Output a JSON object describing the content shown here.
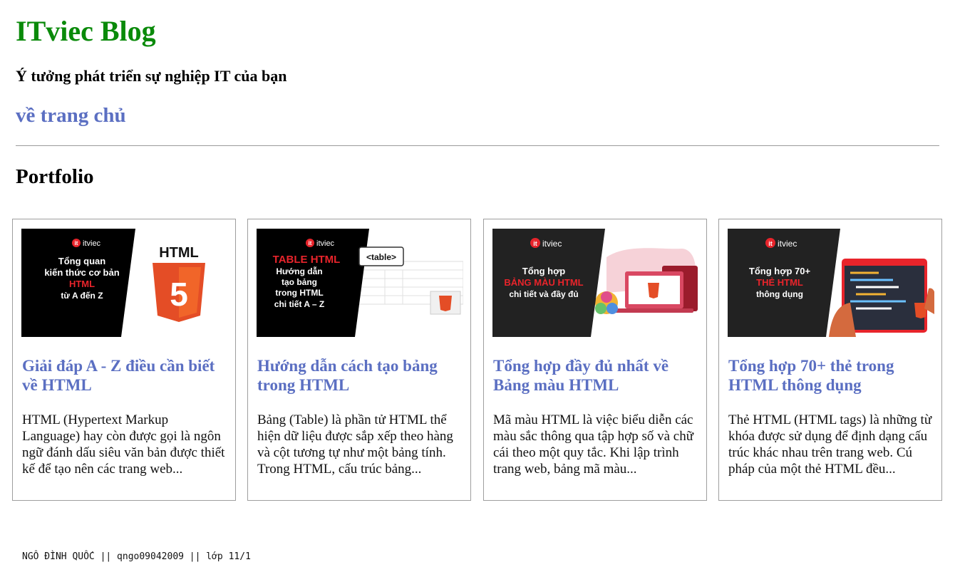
{
  "header": {
    "site_title": "ITviec Blog",
    "tagline": "Ý tưởng phát triển sự nghiệp IT của bạn",
    "home_link": "về trang chủ"
  },
  "section": {
    "title": "Portfolio"
  },
  "cards": [
    {
      "title": "Giải đáp A - Z điều cần biết về HTML",
      "description": "HTML (Hypertext Markup Language) hay còn được gọi là ngôn ngữ đánh dấu siêu văn bản được thiết kế để tạo nên các trang web...",
      "thumb": {
        "logo": "itviec",
        "line1": "Tổng quan",
        "line2": "kiến thức cơ bản",
        "line3": "HTML",
        "line4": "từ A đến Z",
        "badge": "HTML"
      }
    },
    {
      "title": "Hướng dẫn cách tạo bảng trong HTML",
      "description": "Bảng (Table) là phần tử HTML thể hiện dữ liệu được sắp xếp theo hàng và cột tương tự như một bảng tính. Trong HTML, cấu trúc bảng...",
      "thumb": {
        "logo": "itviec",
        "line1": "TABLE HTML",
        "line2": "Hướng dẫn",
        "line3": "tạo bảng",
        "line4": "trong HTML",
        "line5": "chi tiết A – Z",
        "tag": "<table>"
      }
    },
    {
      "title": "Tổng hợp đầy đủ nhất về Bảng màu HTML",
      "description": "Mã màu HTML là việc biểu diễn các màu sắc thông qua tập hợp số và chữ cái theo một quy tắc. Khi lập trình trang web, bảng mã màu...",
      "thumb": {
        "logo": "itviec",
        "line1": "Tổng hợp",
        "line2": "BẢNG MÀU HTML",
        "line3": "chi tiết và đầy đủ"
      }
    },
    {
      "title": "Tổng hợp 70+ thẻ trong HTML thông dụng",
      "description": "Thẻ HTML (HTML tags) là những từ khóa được sử dụng để định dạng cấu trúc khác nhau trên trang web. Cú pháp của một thẻ HTML đều...",
      "thumb": {
        "logo": "itviec",
        "line1": "Tổng hợp 70+",
        "line2": "THẺ HTML",
        "line3": "thông dụng"
      }
    }
  ],
  "footer": {
    "text": "NGÔ ĐÌNH QUỐC || qngo09042009 || lớp 11/1"
  },
  "colors": {
    "site_title": "#0a8a0a",
    "link": "#5b6fc2",
    "brand_red": "#e8242b",
    "thumb_dark": "#222222"
  }
}
